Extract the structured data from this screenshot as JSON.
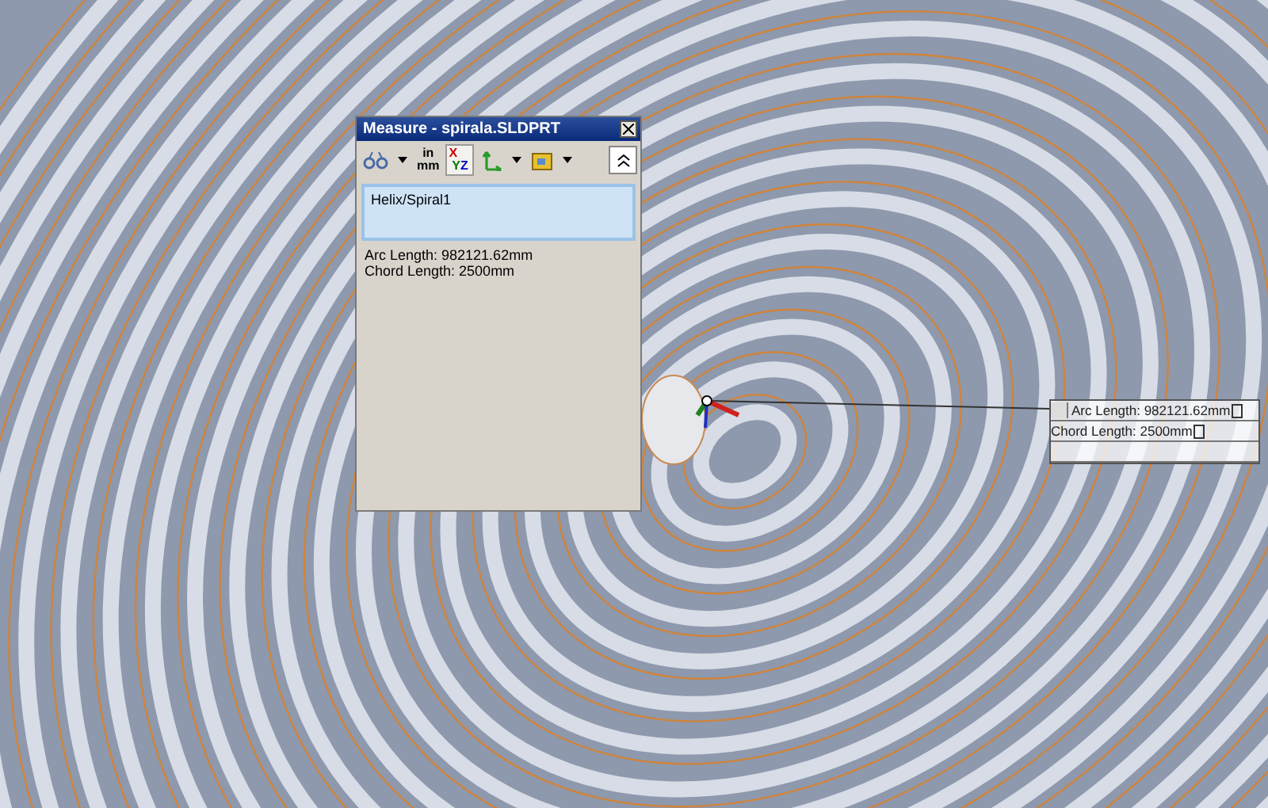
{
  "dialog": {
    "title": "Measure - spirala.SLDPRT",
    "toolbar": [
      {
        "kind": "measure"
      },
      {
        "kind": "caret"
      },
      {
        "kind": "units",
        "top": "in",
        "bottom": "mm"
      },
      {
        "kind": "xyz",
        "selected": true,
        "letters": [
          "X",
          "Y",
          "Z"
        ]
      },
      {
        "kind": "axes"
      },
      {
        "kind": "caret"
      },
      {
        "kind": "folder"
      },
      {
        "kind": "caret"
      }
    ],
    "selection": [
      "Helix/Spiral1"
    ],
    "results": [
      "Arc Length: 982121.62mm",
      "Chord Length: 2500mm"
    ]
  },
  "callout": {
    "lines": [
      "Arc Length: 982121.62mm",
      "Chord Length: 2500mm"
    ]
  }
}
